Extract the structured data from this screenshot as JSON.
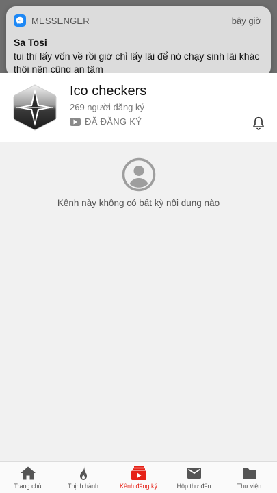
{
  "notification": {
    "app_name": "MESSENGER",
    "time": "bây giờ",
    "sender": "Sa Tosi",
    "message": "tui thì lấy vốn về rồi giờ chỉ lấy lãi để nó chạy sinh lãi khác thôi nên cũng an tâm",
    "app_icon": "messenger-icon"
  },
  "channel": {
    "title": "Ico checkers",
    "subscribers": "269 người đăng ký",
    "subscribed_label": "ĐÃ ĐĂNG KÝ",
    "avatar_icon": "star-logo-icon",
    "notification_icon": "bell-icon"
  },
  "empty_state": {
    "icon": "account-circle-icon",
    "message": "Kênh này không có bất kỳ nội dung nào"
  },
  "bottom_nav": {
    "items": [
      {
        "label": "Trang chủ",
        "icon": "home-icon"
      },
      {
        "label": "Thịnh hành",
        "icon": "flame-icon"
      },
      {
        "label": "Kênh đăng ký",
        "icon": "subscriptions-icon",
        "active": true
      },
      {
        "label": "Hộp thư đến",
        "icon": "mail-icon"
      },
      {
        "label": "Thư viện",
        "icon": "folder-icon"
      }
    ],
    "active_color": "#e62117"
  }
}
